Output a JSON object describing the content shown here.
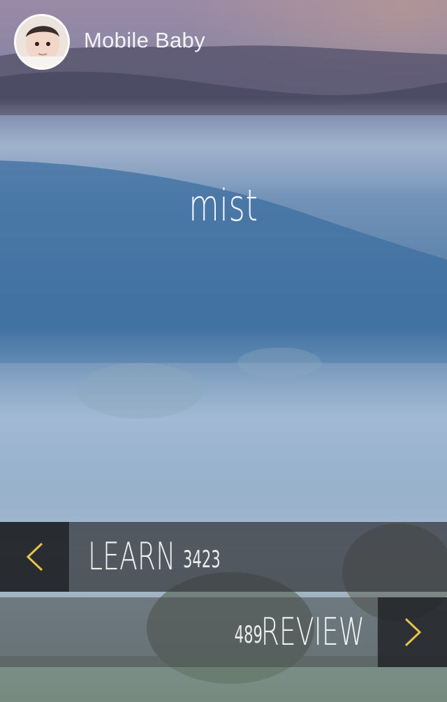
{
  "profile": {
    "name": "Mobile Baby",
    "avatar_icon": "baby-face-icon"
  },
  "card": {
    "word": "mist"
  },
  "learn": {
    "label": "LEARN",
    "count": "3423",
    "button_icon": "chevron-left-icon"
  },
  "review": {
    "label": "REVIEW",
    "count": "489",
    "button_icon": "chevron-right-icon"
  },
  "colors": {
    "accent": "#e8c548",
    "bar_dark": "#202226",
    "bar": "#3a3c40",
    "text": "#ffffff"
  }
}
